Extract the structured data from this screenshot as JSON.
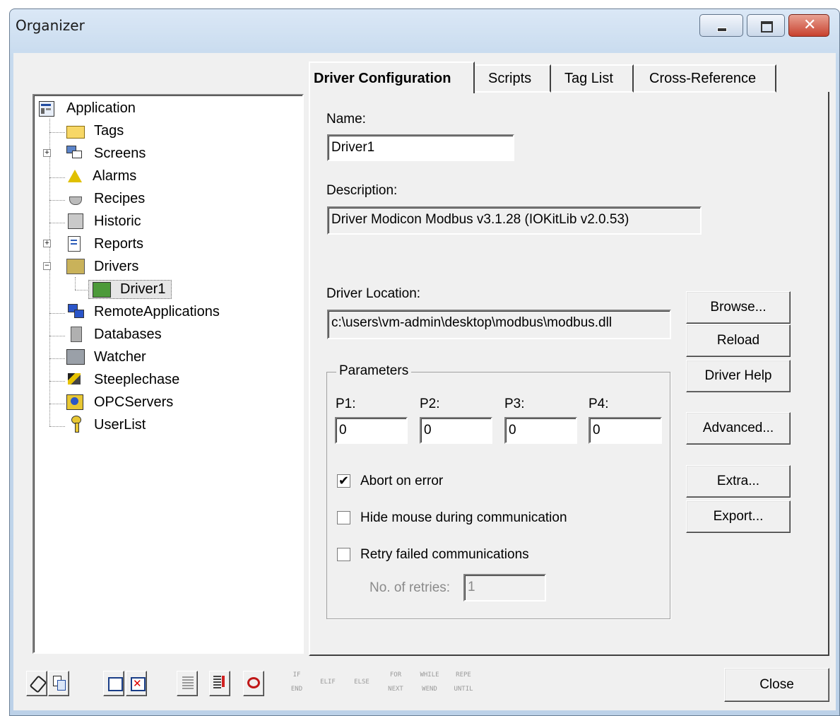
{
  "window": {
    "title": "Organizer"
  },
  "tree": {
    "items": [
      {
        "label": "Application",
        "icon": "application-icon"
      },
      {
        "label": "Tags",
        "icon": "tags-folder-icon"
      },
      {
        "label": "Screens",
        "icon": "screens-icon"
      },
      {
        "label": "Alarms",
        "icon": "alarm-bell-icon"
      },
      {
        "label": "Recipes",
        "icon": "recipes-icon"
      },
      {
        "label": "Historic",
        "icon": "historic-icon"
      },
      {
        "label": "Reports",
        "icon": "reports-icon"
      },
      {
        "label": "Drivers",
        "icon": "drivers-icon"
      },
      {
        "label": "Driver1",
        "icon": "driver-icon"
      },
      {
        "label": "RemoteApplications",
        "icon": "remote-applications-icon"
      },
      {
        "label": "Databases",
        "icon": "databases-icon"
      },
      {
        "label": "Watcher",
        "icon": "watcher-icon"
      },
      {
        "label": "Steeplechase",
        "icon": "steeplechase-icon"
      },
      {
        "label": "OPCServers",
        "icon": "opc-servers-icon"
      },
      {
        "label": "UserList",
        "icon": "key-icon"
      }
    ]
  },
  "tabs": [
    {
      "label": "Driver Configuration"
    },
    {
      "label": "Scripts"
    },
    {
      "label": "Tag List"
    },
    {
      "label": "Cross-Reference"
    }
  ],
  "form": {
    "name_label": "Name:",
    "name_value": "Driver1",
    "description_label": "Description:",
    "description_value": "Driver Modicon Modbus v3.1.28 (IOKitLib v2.0.53)",
    "location_label": "Driver Location:",
    "location_value": "c:\\users\\vm-admin\\desktop\\modbus\\modbus.dll",
    "parameters_label": "Parameters",
    "params": [
      {
        "label": "P1:",
        "value": "0"
      },
      {
        "label": "P2:",
        "value": "0"
      },
      {
        "label": "P3:",
        "value": "0"
      },
      {
        "label": "P4:",
        "value": "0"
      }
    ],
    "abort_label": "Abort on error",
    "abort_checked": true,
    "hide_mouse_label": "Hide mouse during communication",
    "hide_mouse_checked": false,
    "retry_label": "Retry failed communications",
    "retry_checked": false,
    "retries_label": "No. of retries:",
    "retries_value": "1"
  },
  "buttons": {
    "browse": "Browse...",
    "reload": "Reload",
    "driver_help": "Driver Help",
    "advanced": "Advanced...",
    "extra": "Extra...",
    "export": "Export...",
    "close": "Close"
  },
  "toolbar": {
    "script_buttons": [
      {
        "top": "IF",
        "bottom": "END"
      },
      {
        "top": "ELIF",
        "bottom": ""
      },
      {
        "top": "ELSE",
        "bottom": ""
      },
      {
        "top": "FOR",
        "bottom": "NEXT"
      },
      {
        "top": "WHILE",
        "bottom": "WEND"
      },
      {
        "top": "REPE",
        "bottom": "UNTIL"
      }
    ]
  }
}
